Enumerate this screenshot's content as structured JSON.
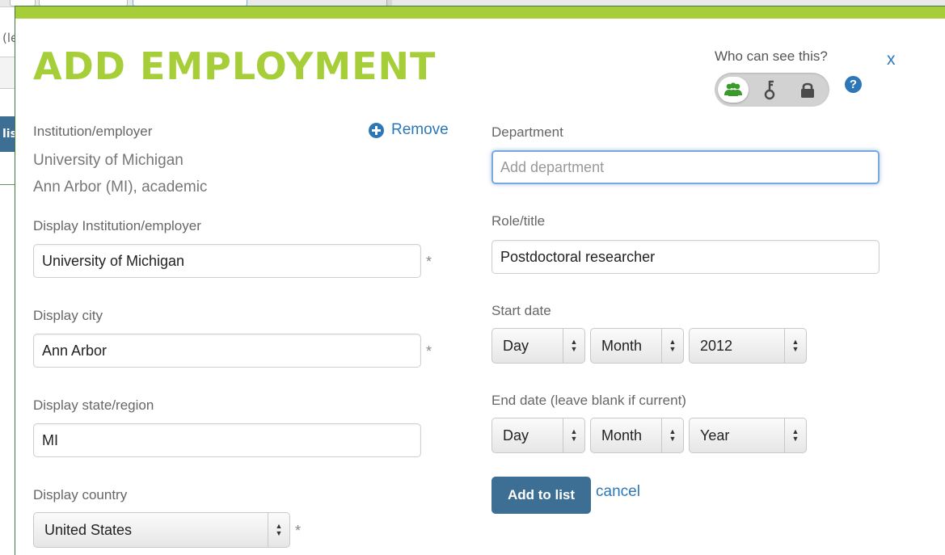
{
  "background": {
    "left_fragment_text": "(le",
    "left_button_text": "lis"
  },
  "modal": {
    "title": "ADD EMPLOYMENT",
    "accent_color": "#a6ce39",
    "link_color": "#2d77b8",
    "privacy": {
      "label": "Who can see this?",
      "options": [
        {
          "name": "everyone",
          "icon": "group-icon",
          "selected": true
        },
        {
          "name": "trusted-parties",
          "icon": "key-icon",
          "selected": false
        },
        {
          "name": "only-me",
          "icon": "lock-icon",
          "selected": false
        }
      ],
      "help_glyph": "?"
    },
    "close_glyph": "x",
    "left": {
      "institution_label": "Institution/employer",
      "institution_name": "University of Michigan",
      "institution_location": "Ann Arbor (MI), academic",
      "remove_label": "Remove",
      "display_institution_label": "Display Institution/employer",
      "display_institution_value": "University of Michigan",
      "display_city_label": "Display city",
      "display_city_value": "Ann Arbor",
      "display_state_label": "Display state/region",
      "display_state_value": "MI",
      "display_country_label": "Display country",
      "display_country_value": "United States",
      "required_marker": "*"
    },
    "right": {
      "department_label": "Department",
      "department_placeholder": "Add department",
      "role_label": "Role/title",
      "role_value": "Postdoctoral researcher",
      "start_date_label": "Start date",
      "start_date": {
        "day": "Day",
        "month": "Month",
        "year": "2012"
      },
      "end_date_label": "End date (leave blank if current)",
      "end_date": {
        "day": "Day",
        "month": "Month",
        "year": "Year"
      },
      "add_button": "Add to list",
      "cancel_link": "cancel"
    }
  }
}
